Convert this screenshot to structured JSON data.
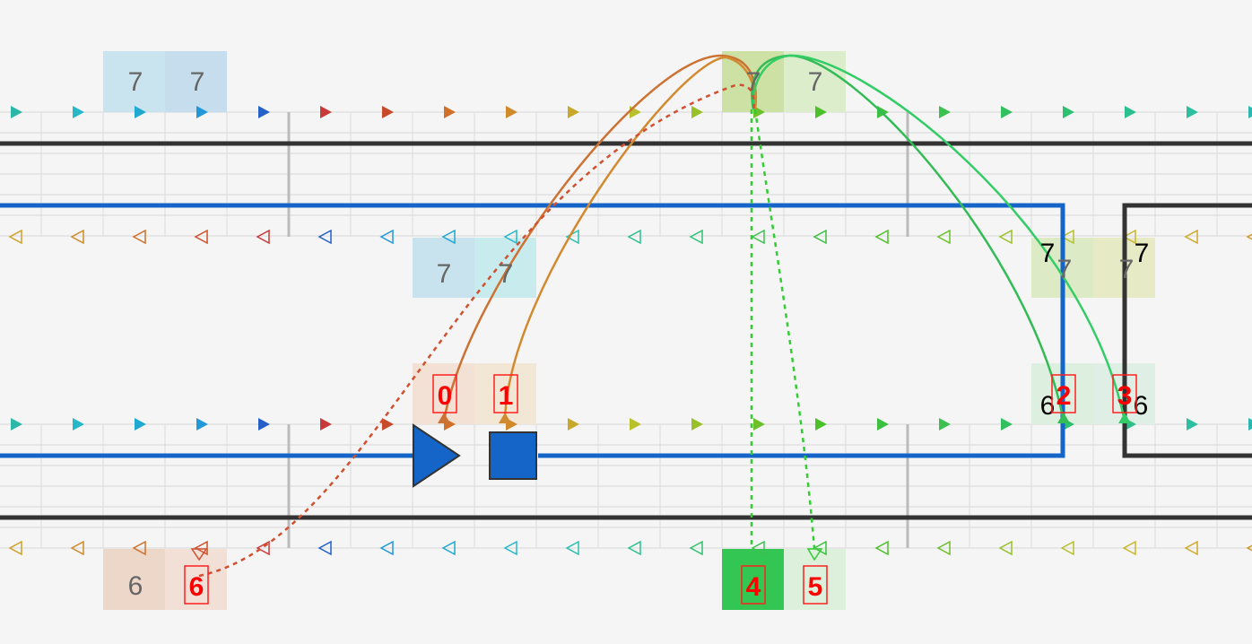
{
  "colors": {
    "background": "#f5f5f5",
    "route_blue": "#1565c8",
    "route_black": "#333333",
    "marker_red": "#ff0000",
    "arc_orange": "#d07a30",
    "arc_green": "#33cc66",
    "dashed_red": "#d05030",
    "dashed_green": "#33cc33"
  },
  "top_cells": [
    {
      "label": "7"
    },
    {
      "label": "7"
    },
    {
      "label": "7"
    },
    {
      "label": "7"
    },
    {
      "label": "7"
    },
    {
      "label": "7"
    },
    {
      "label": "7"
    },
    {
      "label": "7"
    }
  ],
  "bottom_cells": [
    {
      "label": "6"
    }
  ],
  "markers": [
    {
      "label": "0"
    },
    {
      "label": "1"
    },
    {
      "label": "2"
    },
    {
      "label": "3"
    },
    {
      "label": "4"
    },
    {
      "label": "5"
    },
    {
      "label": "6"
    }
  ],
  "side_labels": [
    {
      "label": "7"
    },
    {
      "label": "7"
    },
    {
      "label": "6"
    },
    {
      "label": "6"
    }
  ],
  "symbols": {
    "play": "play-triangle-icon",
    "stop": "stop-square-icon"
  }
}
